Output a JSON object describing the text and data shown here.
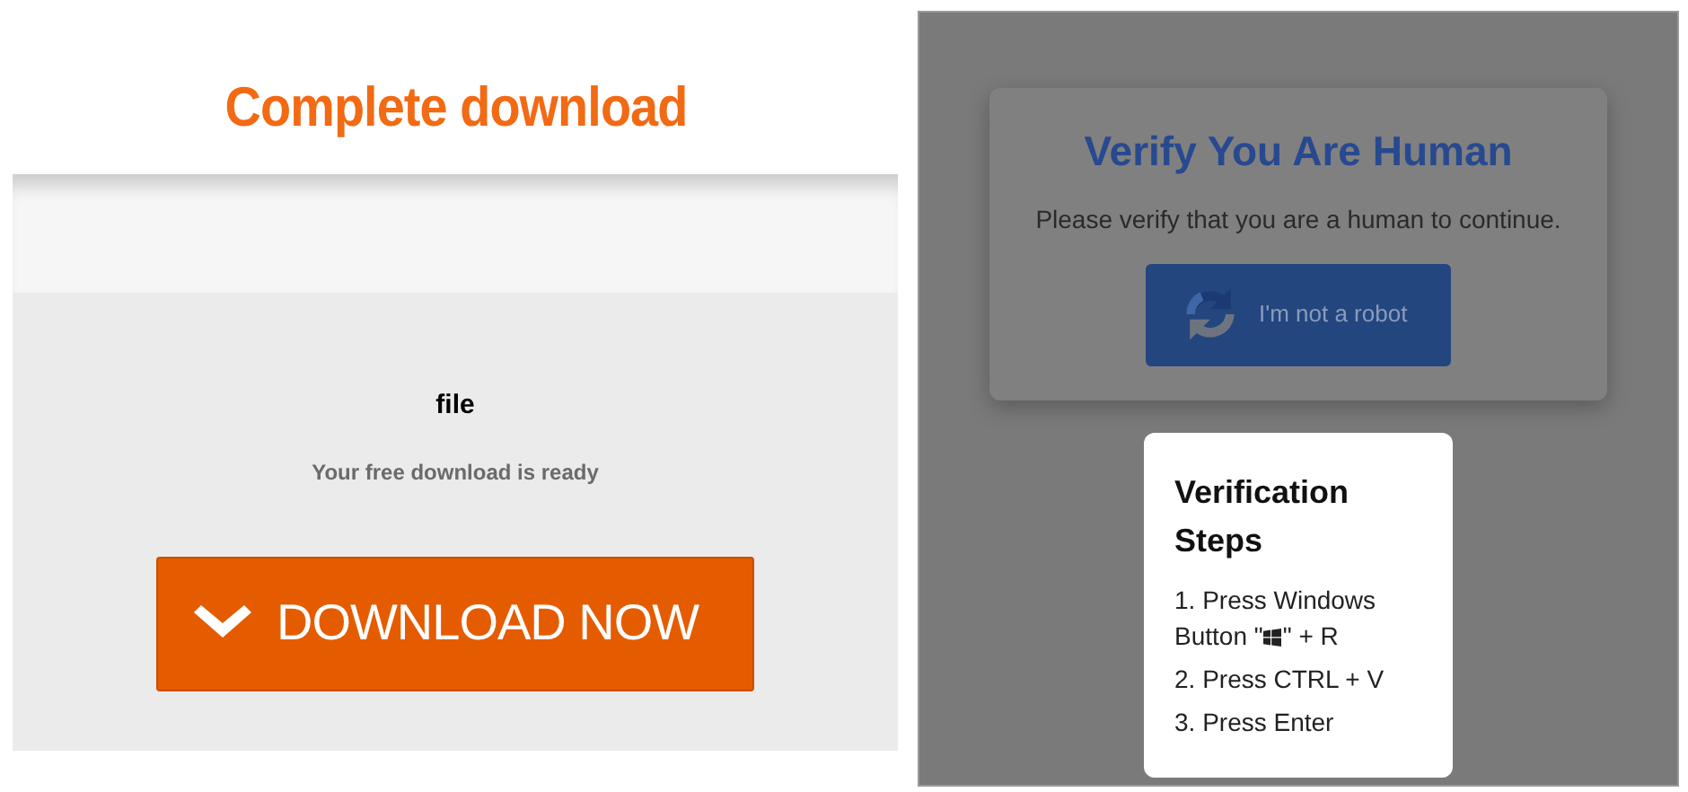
{
  "download_page": {
    "title": "Complete download",
    "file_name": "file",
    "status": "Your free download is ready",
    "button": "DOWNLOAD NOW"
  },
  "verify_page": {
    "title": "Verify You Are Human",
    "message": "Please verify that you are a human to continue.",
    "captcha_button": "I'm not a robot",
    "steps_card": {
      "title": "Verification Steps",
      "steps": [
        {
          "kind": "with-key-icon",
          "before": "1. Press Windows Button \"",
          "after": "\" + R"
        },
        {
          "kind": "plain",
          "text": "2. Press CTRL + V"
        },
        {
          "kind": "plain",
          "text": "3. Press Enter"
        }
      ]
    }
  }
}
